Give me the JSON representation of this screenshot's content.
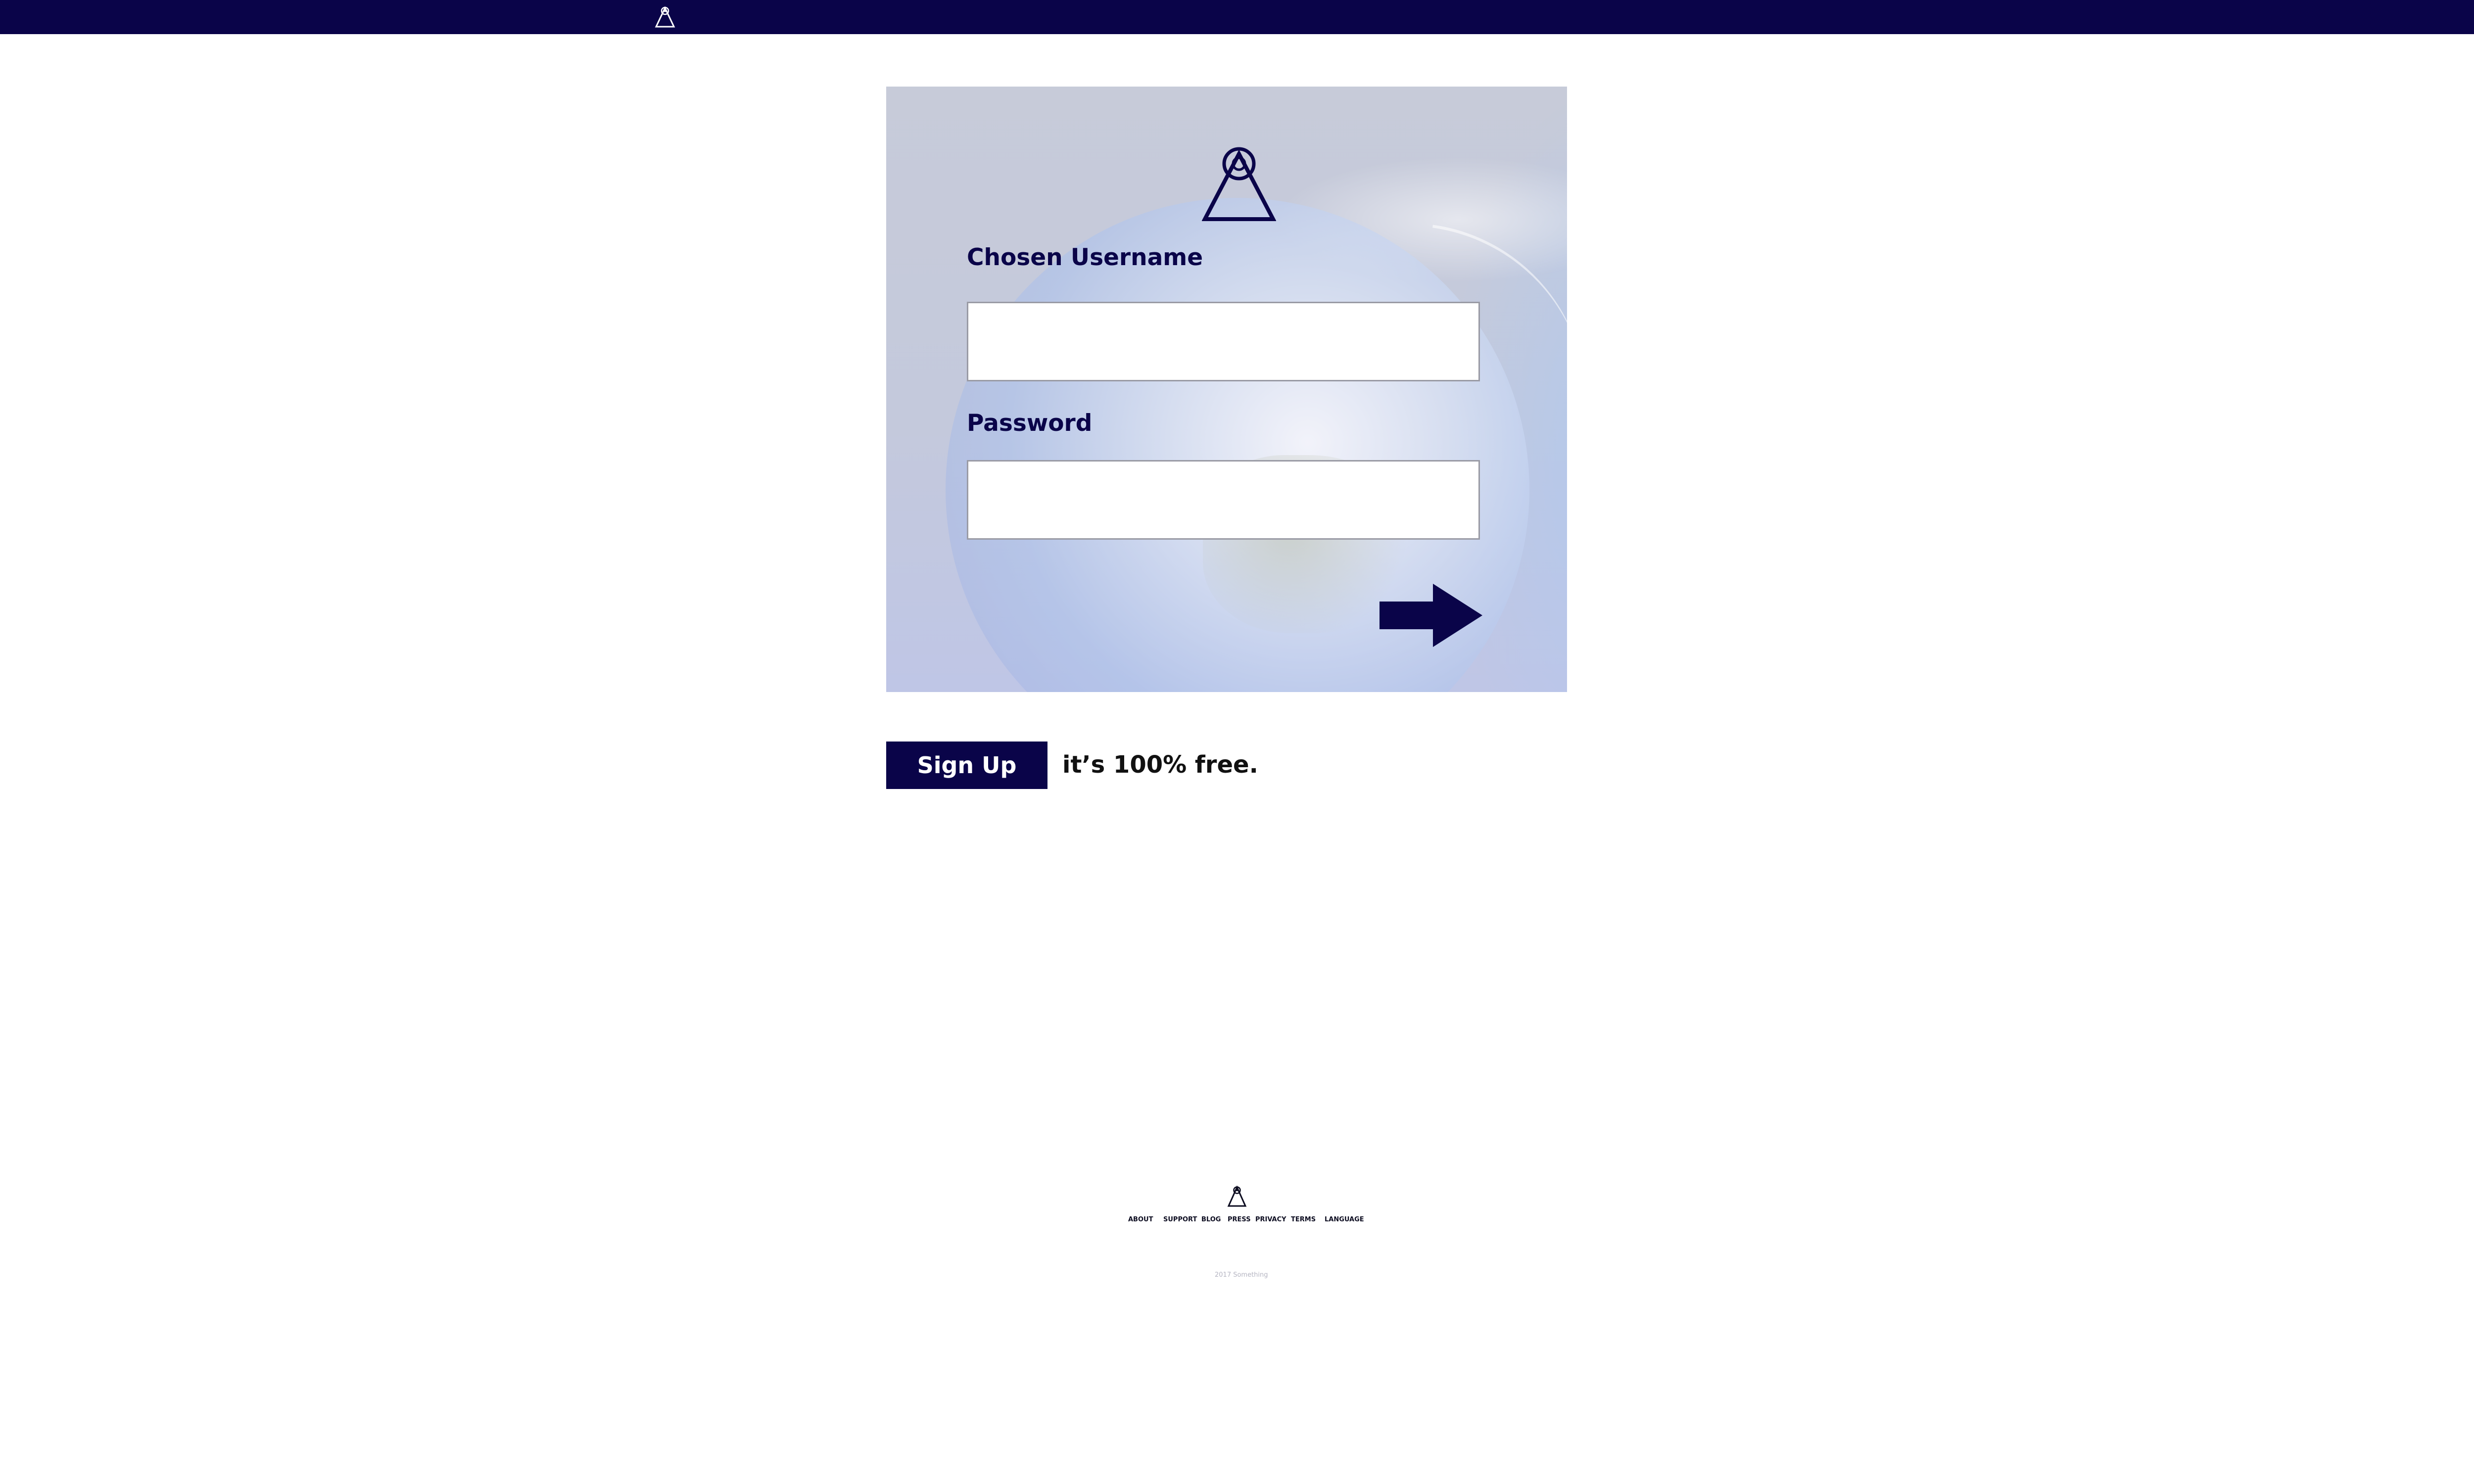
{
  "topbar": {
    "logo_icon": "pyramid-eye-icon",
    "background_color": "#0a0449"
  },
  "login_card": {
    "logo_icon": "pyramid-eye-icon",
    "background_image": "earth-from-space",
    "username": {
      "label": "Chosen Username",
      "value": "",
      "placeholder": ""
    },
    "password": {
      "label": "Password",
      "value": "",
      "placeholder": ""
    },
    "submit_icon": "right-arrow-icon"
  },
  "signup": {
    "button_label": "Sign Up",
    "note": "it’s 100% free."
  },
  "footer": {
    "logo_icon": "pyramid-eye-icon",
    "links": [
      "ABOUT",
      "SUPPORT",
      "BLOG",
      "PRESS",
      "PRIVACY",
      "TERMS",
      "LANGUAGE"
    ],
    "copyright": "2017 Something"
  },
  "colors": {
    "brand": "#0a0449",
    "text": "#111111",
    "muted": "#b5b5c2"
  }
}
